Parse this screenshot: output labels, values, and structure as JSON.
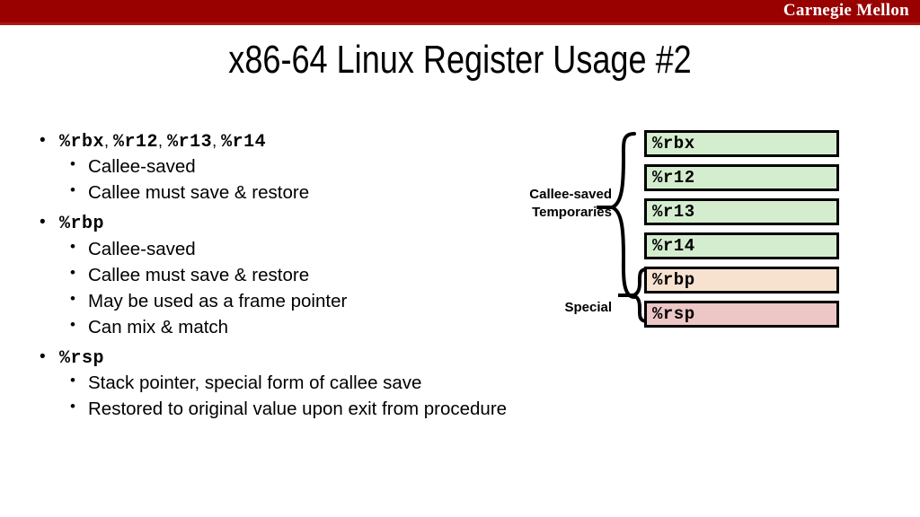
{
  "header": {
    "brand": "Carnegie Mellon",
    "bar_color": "#990000",
    "underline_color": "#b01515"
  },
  "title": "x86-64 Linux Register Usage #2",
  "content": {
    "groups": [
      {
        "heading_parts": [
          "%rbx",
          "%r12",
          "%r13",
          "%r14"
        ],
        "heading_separator": ", ",
        "bullet": "•",
        "sub_bullets": [
          "Callee-saved",
          "Callee must save & restore"
        ]
      },
      {
        "heading_parts": [
          "%rbp"
        ],
        "heading_separator": ", ",
        "bullet": "•",
        "sub_bullets": [
          "Callee-saved",
          "Callee must save & restore",
          "May be used as a frame pointer",
          "Can mix & match"
        ]
      },
      {
        "heading_parts": [
          "%rsp"
        ],
        "heading_separator": ", ",
        "bullet": "•",
        "sub_bullets": [
          "Stack pointer, special form of callee save",
          "Restored to original value upon exit from procedure"
        ]
      }
    ]
  },
  "diagram": {
    "labels": {
      "callee_saved_line1": "Callee-saved",
      "callee_saved_line2": "Temporaries",
      "special": "Special"
    },
    "registers": [
      {
        "name": "%rbx",
        "color": "#d4edcf"
      },
      {
        "name": "%r12",
        "color": "#d4edcf"
      },
      {
        "name": "%r13",
        "color": "#d4edcf"
      },
      {
        "name": "%r14",
        "color": "#d4edcf"
      },
      {
        "name": "%rbp",
        "color": "#f7e2d0"
      },
      {
        "name": "%rsp",
        "color": "#edc6c6"
      }
    ]
  }
}
